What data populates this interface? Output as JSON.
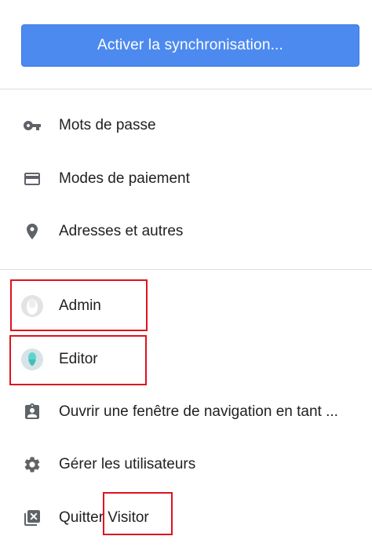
{
  "sync": {
    "label": "Activer la synchronisation..."
  },
  "autofill": {
    "items": [
      {
        "label": "Mots de passe",
        "icon": "key-icon"
      },
      {
        "label": "Modes de paiement",
        "icon": "credit-card-icon"
      },
      {
        "label": "Adresses et autres",
        "icon": "location-pin-icon"
      }
    ]
  },
  "profiles": {
    "items": [
      {
        "label": "Admin",
        "icon": "avatar-grey-icon"
      },
      {
        "label": "Editor",
        "icon": "avatar-teal-icon"
      }
    ]
  },
  "actions": {
    "items": [
      {
        "label": "Ouvrir une fenêtre de navigation en tant ...",
        "icon": "guest-badge-icon"
      },
      {
        "label": "Gérer les utilisateurs",
        "icon": "gear-icon"
      },
      {
        "label": "Quitter Visitor",
        "icon": "close-box-icon"
      }
    ]
  },
  "colors": {
    "accent": "#4d8af0",
    "highlight": "#e0121e",
    "icon": "#5f6368"
  }
}
